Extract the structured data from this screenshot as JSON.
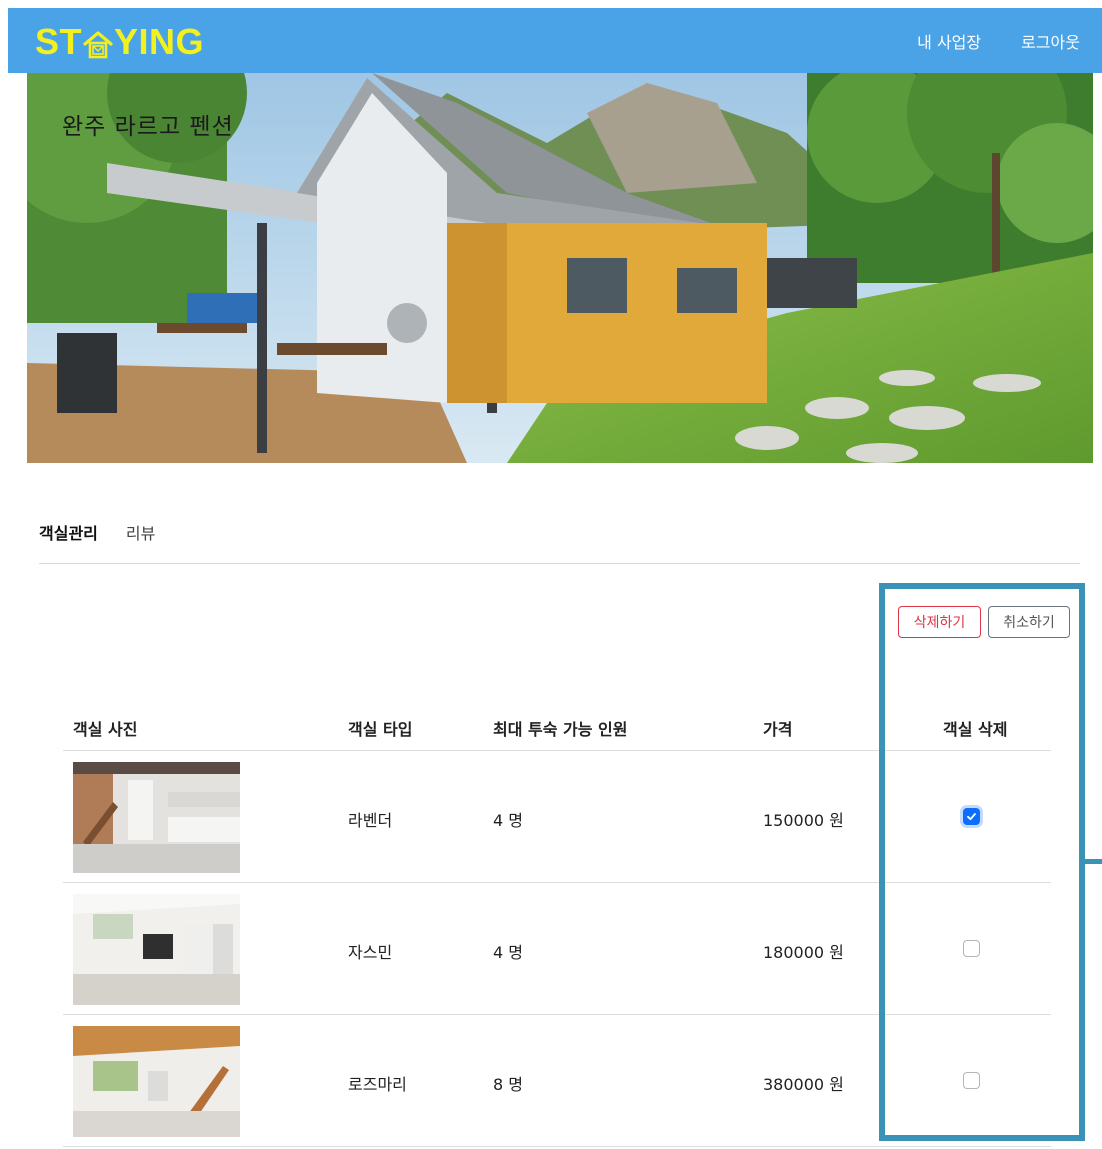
{
  "header": {
    "logo_left": "ST",
    "logo_right": "YING",
    "nav": [
      "내 사업장",
      "로그아웃"
    ]
  },
  "hero": {
    "title": "완주 라르고 펜션"
  },
  "tabs": [
    {
      "label": "객실관리",
      "active": true
    },
    {
      "label": "리뷰",
      "active": false
    }
  ],
  "actions": {
    "delete_label": "삭제하기",
    "cancel_label": "취소하기"
  },
  "table": {
    "columns": [
      "객실 사진",
      "객실 타입",
      "최대 투숙 가능 인원",
      "가격",
      "객실 삭제"
    ],
    "rows": [
      {
        "type": "라벤더",
        "capacity": "4 명",
        "price": "150000 원",
        "checked": true
      },
      {
        "type": "자스민",
        "capacity": "4 명",
        "price": "180000 원",
        "checked": false
      },
      {
        "type": "로즈마리",
        "capacity": "8 명",
        "price": "380000 원",
        "checked": false
      }
    ]
  },
  "colors": {
    "header": "#4aa3e6",
    "logo": "#f4ef1f",
    "highlight": "#3a93b7",
    "danger": "#dc3545",
    "check": "#0d6efd"
  },
  "icons": {
    "logo": "house-icon",
    "check": "check-icon"
  }
}
